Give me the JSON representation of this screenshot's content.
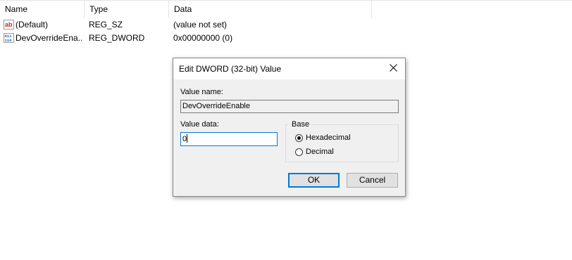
{
  "list": {
    "headers": {
      "name": "Name",
      "type": "Type",
      "data": "Data"
    },
    "rows": [
      {
        "name": "(Default)",
        "type": "REG_SZ",
        "data": "(value not set)",
        "icon": "string-value-icon"
      },
      {
        "name": "DevOverrideEna...",
        "type": "REG_DWORD",
        "data": "0x00000000 (0)",
        "icon": "binary-value-icon"
      }
    ]
  },
  "dialog": {
    "title": "Edit DWORD (32-bit) Value",
    "close_icon": "close-icon",
    "value_name_label": "Value name:",
    "value_name": "DevOverrideEnable",
    "value_data_label": "Value data:",
    "value_data": "0",
    "base_label": "Base",
    "base_options": [
      {
        "label": "Hexadecimal",
        "selected": true
      },
      {
        "label": "Decimal",
        "selected": false
      }
    ],
    "ok_label": "OK",
    "cancel_label": "Cancel"
  },
  "colors": {
    "focus_accent": "#0078d7",
    "dialog_bg": "#f0f0f0",
    "value_icon_red": "#c42b1c",
    "value_icon_blue": "#1b5fb8"
  }
}
